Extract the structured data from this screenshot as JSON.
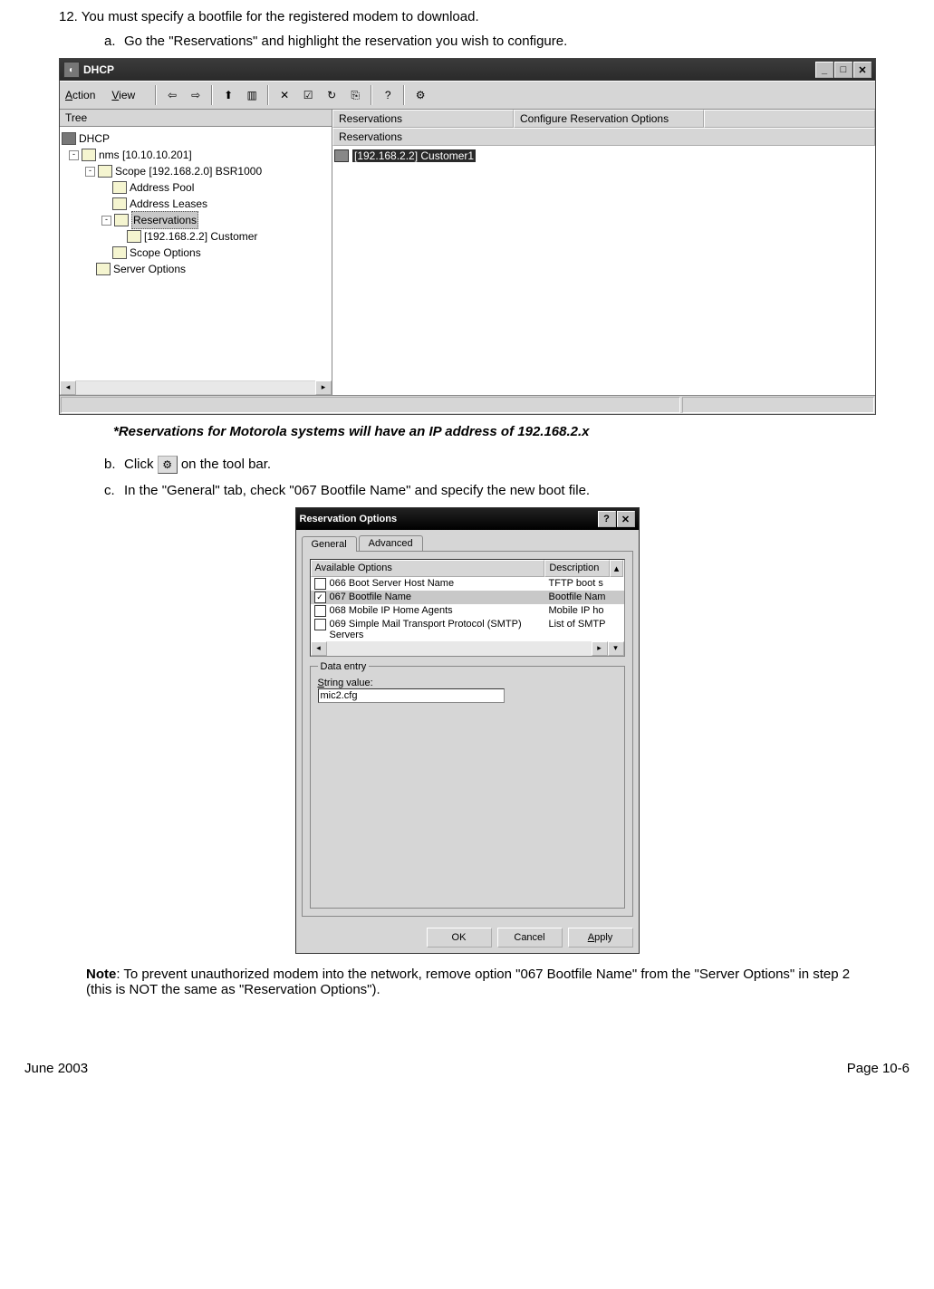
{
  "doc": {
    "step12": "12. You must specify a bootfile for the registered modem to download.",
    "step_a": "Go the \"Reservations\" and highlight the reservation you wish to configure.",
    "caption": "*Reservations for Motorola systems will have an IP address of 192.168.2.x",
    "step_b_pre": "Click ",
    "step_b_post": " on the tool bar.",
    "step_c": "In the \"General\" tab, check \"067 Bootfile Name\" and specify the new boot file.",
    "note": "Note: To prevent unauthorized modem into the network, remove option \"067 Bootfile Name\" from the \"Server Options\" in step 2 (this is NOT the same as \"Reservation Options\").",
    "note_prefix": "Note",
    "footer_left": "June 2003",
    "footer_right": "Page 10-6"
  },
  "win1": {
    "title": "DHCP",
    "menu": {
      "action": "Action",
      "view": "View"
    },
    "tree_tab": "Tree",
    "col_reservations": "Reservations",
    "col_config": "Configure Reservation Options",
    "col_reservations2": "Reservations",
    "tree": {
      "root": "DHCP",
      "nms": "nms [10.10.10.201]",
      "scope": "Scope [192.168.2.0] BSR1000",
      "pool": "Address Pool",
      "leases": "Address Leases",
      "reservations": "Reservations",
      "res_item": "[192.168.2.2] Customer",
      "scope_opts": "Scope Options",
      "server_opts": "Server Options"
    },
    "list_item": "[192.168.2.2] Customer1"
  },
  "dlg": {
    "title": "Reservation Options",
    "tab_general": "General",
    "tab_advanced": "Advanced",
    "col_avail": "Available Options",
    "col_desc": "Description",
    "opt066": {
      "label": "066 Boot Server Host Name",
      "desc": "TFTP boot s"
    },
    "opt067": {
      "label": "067 Bootfile Name",
      "desc": "Bootfile Nam"
    },
    "opt068": {
      "label": "068 Mobile IP Home Agents",
      "desc": "Mobile IP ho"
    },
    "opt069": {
      "label": "069 Simple Mail Transport Protocol (SMTP) Servers",
      "desc": "List of SMTP"
    },
    "data_entry": "Data entry",
    "string_label": "String value:",
    "string_value": "mic2.cfg",
    "ok": "OK",
    "cancel": "Cancel",
    "apply": "Apply"
  }
}
